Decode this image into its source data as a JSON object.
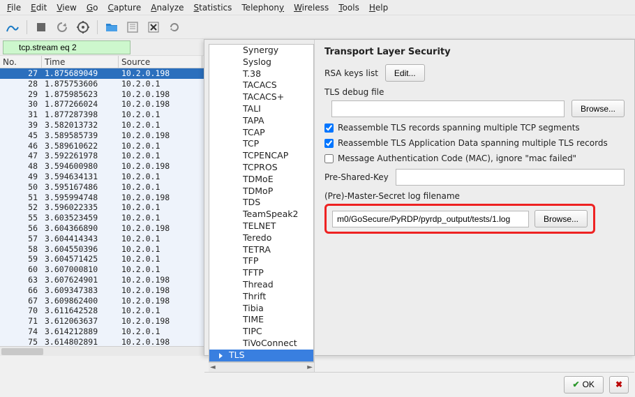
{
  "menubar": [
    {
      "label": "File",
      "mnemonic": 0
    },
    {
      "label": "Edit",
      "mnemonic": 0
    },
    {
      "label": "View",
      "mnemonic": 0
    },
    {
      "label": "Go",
      "mnemonic": 0
    },
    {
      "label": "Capture",
      "mnemonic": 0
    },
    {
      "label": "Analyze",
      "mnemonic": 0
    },
    {
      "label": "Statistics",
      "mnemonic": 0
    },
    {
      "label": "Telephony",
      "mnemonic": 8
    },
    {
      "label": "Wireless",
      "mnemonic": 0
    },
    {
      "label": "Tools",
      "mnemonic": 0
    },
    {
      "label": "Help",
      "mnemonic": 0
    }
  ],
  "filter": {
    "value": "tcp.stream eq 2"
  },
  "packet_list": {
    "headers": [
      "No.",
      "Time",
      "Source"
    ],
    "rows": [
      {
        "no": 27,
        "time": "1.875689049",
        "src": "10.2.0.198",
        "sel": true
      },
      {
        "no": 28,
        "time": "1.875753606",
        "src": "10.2.0.1"
      },
      {
        "no": 29,
        "time": "1.875985623",
        "src": "10.2.0.198"
      },
      {
        "no": 30,
        "time": "1.877266024",
        "src": "10.2.0.198"
      },
      {
        "no": 31,
        "time": "1.877287398",
        "src": "10.2.0.1"
      },
      {
        "no": 39,
        "time": "3.582013732",
        "src": "10.2.0.1"
      },
      {
        "no": 45,
        "time": "3.589585739",
        "src": "10.2.0.198"
      },
      {
        "no": 46,
        "time": "3.589610622",
        "src": "10.2.0.1"
      },
      {
        "no": 47,
        "time": "3.592261978",
        "src": "10.2.0.1"
      },
      {
        "no": 48,
        "time": "3.594600980",
        "src": "10.2.0.198"
      },
      {
        "no": 49,
        "time": "3.594634131",
        "src": "10.2.0.1"
      },
      {
        "no": 50,
        "time": "3.595167486",
        "src": "10.2.0.1"
      },
      {
        "no": 51,
        "time": "3.595994748",
        "src": "10.2.0.198"
      },
      {
        "no": 52,
        "time": "3.596022335",
        "src": "10.2.0.1"
      },
      {
        "no": 55,
        "time": "3.603523459",
        "src": "10.2.0.1"
      },
      {
        "no": 56,
        "time": "3.604366890",
        "src": "10.2.0.198"
      },
      {
        "no": 57,
        "time": "3.604414343",
        "src": "10.2.0.1"
      },
      {
        "no": 58,
        "time": "3.604550396",
        "src": "10.2.0.1"
      },
      {
        "no": 59,
        "time": "3.604571425",
        "src": "10.2.0.1"
      },
      {
        "no": 60,
        "time": "3.607000810",
        "src": "10.2.0.1"
      },
      {
        "no": 63,
        "time": "3.607624901",
        "src": "10.2.0.198"
      },
      {
        "no": 66,
        "time": "3.609347383",
        "src": "10.2.0.198"
      },
      {
        "no": 67,
        "time": "3.609862400",
        "src": "10.2.0.198"
      },
      {
        "no": 70,
        "time": "3.611642528",
        "src": "10.2.0.1"
      },
      {
        "no": 71,
        "time": "3.612063637",
        "src": "10.2.0.198"
      },
      {
        "no": 74,
        "time": "3.614212889",
        "src": "10.2.0.1"
      },
      {
        "no": 75,
        "time": "3.614802891",
        "src": "10.2.0.198"
      }
    ]
  },
  "prefs": {
    "title": "Transport Layer Security",
    "rsa_keys_label": "RSA keys list",
    "edit_btn": "Edit...",
    "debug_file_label": "TLS debug file",
    "debug_file_value": "",
    "browse_btn": "Browse...",
    "chk_reassemble_tcp": "Reassemble TLS records spanning multiple TCP segments",
    "chk_reassemble_tls": "Reassemble TLS Application Data spanning multiple TLS records",
    "chk_mac_ignore": "Message Authentication Code (MAC), ignore \"mac failed\"",
    "psk_label": "Pre-Shared-Key",
    "psk_value": "",
    "master_secret_label": "(Pre)-Master-Secret log filename",
    "master_secret_value": "m0/GoSecure/PyRDP/pyrdp_output/tests/1.log",
    "ok_btn": "OK",
    "chk_states": {
      "tcp": true,
      "tls": true,
      "mac": false
    }
  },
  "protocols": [
    "Synergy",
    "Syslog",
    "T.38",
    "TACACS",
    "TACACS+",
    "TALI",
    "TAPA",
    "TCAP",
    "TCP",
    "TCPENCAP",
    "TCPROS",
    "TDMoE",
    "TDMoP",
    "TDS",
    "TeamSpeak2",
    "TELNET",
    "Teredo",
    "TETRA",
    "TFP",
    "TFTP",
    "Thread",
    "Thrift",
    "Tibia",
    "TIME",
    "TIPC",
    "TiVoConnect",
    "TLS"
  ],
  "protocols_selected": "TLS"
}
